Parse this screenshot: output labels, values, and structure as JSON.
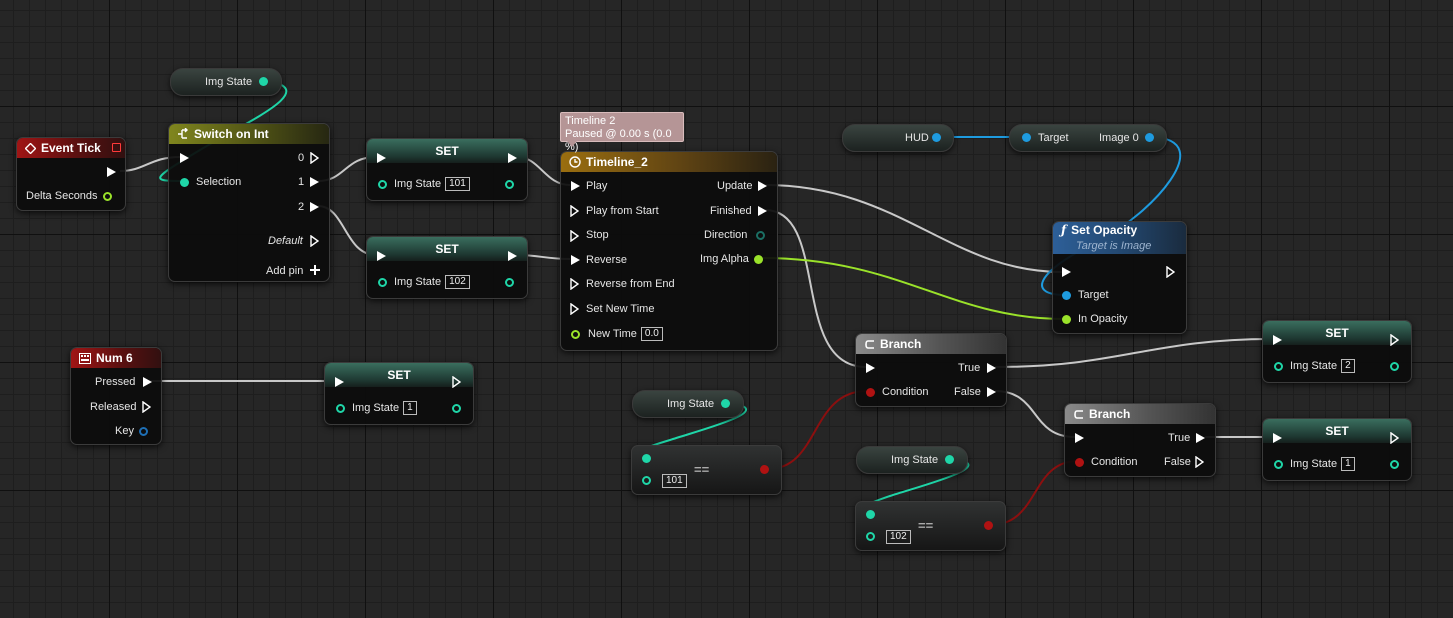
{
  "variables": {
    "img_state_1": "Img State",
    "hud": "HUD",
    "img_state_2": "Img State",
    "img_state_3": "Img State"
  },
  "event_tick": {
    "title": "Event Tick",
    "delta": "Delta Seconds"
  },
  "switch_node": {
    "title": "Switch on Int",
    "selection": "Selection",
    "out0": "0",
    "out1": "1",
    "out2": "2",
    "default": "Default",
    "add_pin": "Add pin"
  },
  "set_nodes": [
    {
      "title": "SET",
      "label": "Img State",
      "value": "101"
    },
    {
      "title": "SET",
      "label": "Img State",
      "value": "102"
    },
    {
      "title": "SET",
      "label": "Img State",
      "value": "1"
    },
    {
      "title": "SET",
      "label": "Img State",
      "value": "2"
    },
    {
      "title": "SET",
      "label": "Img State",
      "value": "1"
    }
  ],
  "tooltip": {
    "line1": "Timeline 2",
    "line2": "Paused @ 0.00 s (0.0 %)"
  },
  "timeline": {
    "title": "Timeline_2",
    "inputs": [
      "Play",
      "Play from Start",
      "Stop",
      "Reverse",
      "Reverse from End",
      "Set New Time",
      "New Time"
    ],
    "new_time_value": "0.0",
    "outputs": [
      "Update",
      "Finished",
      "Direction",
      "Img Alpha"
    ]
  },
  "target_node": {
    "target": "Target",
    "image": "Image 0"
  },
  "set_opacity": {
    "title": "Set Opacity",
    "subtitle": "Target is Image",
    "target": "Target",
    "in_opacity": "In Opacity"
  },
  "num6": {
    "title": "Num 6",
    "pressed": "Pressed",
    "released": "Released",
    "key": "Key"
  },
  "equals_nodes": [
    {
      "op": "==",
      "value": "101"
    },
    {
      "op": "==",
      "value": "102"
    }
  ],
  "branches": [
    {
      "title": "Branch",
      "true_label": "True",
      "false_label": "False",
      "condition": "Condition"
    },
    {
      "title": "Branch",
      "true_label": "True",
      "false_label": "False",
      "condition": "Condition"
    }
  ],
  "colors": {
    "exec_wire": "#c8c8c8",
    "int_wire": "#1fd6a8",
    "object_wire": "#1e9bdf",
    "float_wire": "#9ae22a",
    "bool_wire": "#8c0f0f"
  }
}
